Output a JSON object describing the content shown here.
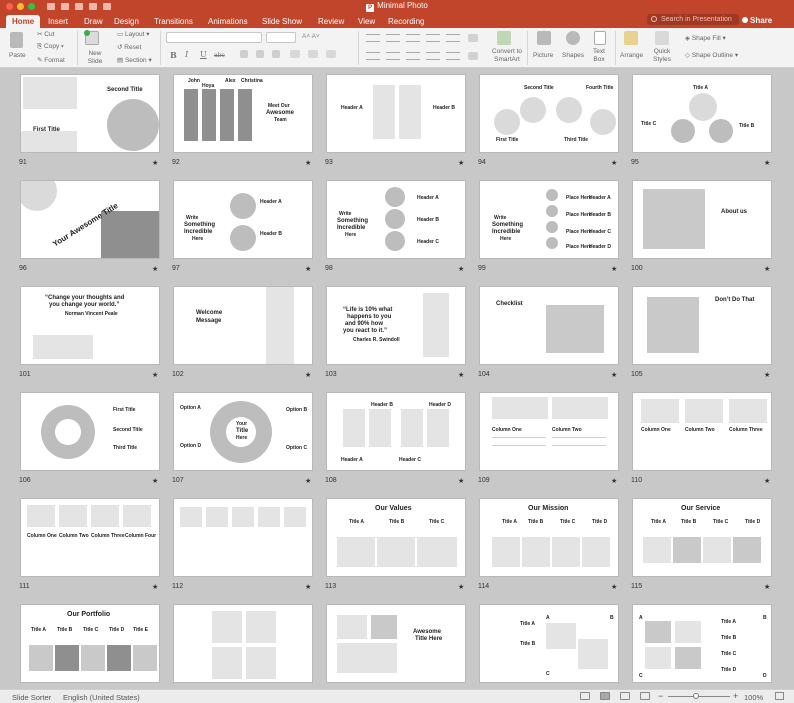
{
  "app": {
    "window_title": "Minimal Photo",
    "colors": {
      "accent": "#c0452b",
      "tab_bg": "#f3f3f3",
      "sorter_bg": "#c8c8c8"
    }
  },
  "tabs": [
    "Home",
    "Insert",
    "Draw",
    "Design",
    "Transitions",
    "Animations",
    "Slide Show",
    "Review",
    "View",
    "Recording"
  ],
  "active_tab": "Home",
  "search": {
    "placeholder": "Search in Presentation"
  },
  "share_label": "Share",
  "ribbon": {
    "paste": "Paste",
    "cut": "Cut",
    "copy": "Copy",
    "format": "Format",
    "new_slide": "New Slide",
    "layout": "Layout",
    "reset": "Reset",
    "section": "Section",
    "convert_smartart": "Convert to SmartArt",
    "picture": "Picture",
    "shapes": "Shapes",
    "text_box": "Text Box",
    "arrange": "Arrange",
    "quick_styles": "Quick Styles",
    "shape_fill": "Shape Fill",
    "shape_outline": "Shape Outline",
    "bold": "B",
    "italic": "I",
    "underline": "U",
    "strike": "abc",
    "font_up": "A˄",
    "font_down": "A˅"
  },
  "slides": [
    {
      "num": "91",
      "texts": [
        "Second Title",
        "First Title"
      ]
    },
    {
      "num": "92",
      "texts": [
        "John",
        "Hoya",
        "Alex",
        "Christina",
        "Meet Our",
        "Awesome",
        "Team"
      ]
    },
    {
      "num": "93",
      "texts": [
        "Header A",
        "Header B"
      ]
    },
    {
      "num": "94",
      "texts": [
        "Second Title",
        "Fourth Title",
        "First Title",
        "Third Title"
      ]
    },
    {
      "num": "95",
      "texts": [
        "Title A",
        "Title C",
        "Title B"
      ]
    },
    {
      "num": "96",
      "texts": [
        "Your Awesome Title"
      ]
    },
    {
      "num": "97",
      "texts": [
        "Write",
        "Something",
        "Incredible",
        "Here",
        "Header A",
        "Header B"
      ]
    },
    {
      "num": "98",
      "texts": [
        "Write",
        "Something",
        "Incredible",
        "Here",
        "Header A",
        "Header B",
        "Header C"
      ]
    },
    {
      "num": "99",
      "texts": [
        "Write",
        "Something",
        "Incredible",
        "Here",
        "Place Here",
        "Header A",
        "Place Here",
        "Header B",
        "Place Here",
        "Header C",
        "Place Here",
        "Header D"
      ]
    },
    {
      "num": "100",
      "texts": [
        "About us"
      ]
    },
    {
      "num": "101",
      "texts": [
        "“Change your thoughts and",
        "you change your world.”",
        "Norman Vincent Peale"
      ]
    },
    {
      "num": "102",
      "texts": [
        "Welcome",
        "Message"
      ]
    },
    {
      "num": "103",
      "texts": [
        "“Life is 10% what",
        "happens to you",
        "and 90% how",
        "you react to it.”",
        "Charles R. Swindoll"
      ]
    },
    {
      "num": "104",
      "texts": [
        "Checklist"
      ]
    },
    {
      "num": "105",
      "texts": [
        "Don’t Do That"
      ]
    },
    {
      "num": "106",
      "texts": [
        "First Title",
        "Second Title",
        "Third Title"
      ]
    },
    {
      "num": "107",
      "texts": [
        "Your",
        "Title",
        "Here",
        "Option A",
        "Option B",
        "Option D",
        "Option C"
      ]
    },
    {
      "num": "108",
      "texts": [
        "Header B",
        "Header D",
        "Header A",
        "Header C"
      ]
    },
    {
      "num": "109",
      "texts": [
        "Column One",
        "Column Two"
      ]
    },
    {
      "num": "110",
      "texts": [
        "Column One",
        "Column Two",
        "Column Three"
      ]
    },
    {
      "num": "111",
      "texts": [
        "Column One",
        "Column Two",
        "Column Three",
        "Column Four"
      ]
    },
    {
      "num": "112",
      "texts": []
    },
    {
      "num": "113",
      "texts": [
        "Our Values",
        "Title A",
        "Title B",
        "Title C"
      ]
    },
    {
      "num": "114",
      "texts": [
        "Our Mission",
        "Title A",
        "Title B",
        "Title C",
        "Title D"
      ]
    },
    {
      "num": "115",
      "texts": [
        "Our Service",
        "Title A",
        "Title B",
        "Title C",
        "Title D"
      ]
    },
    {
      "num": "116",
      "texts": [
        "Our Portfolio",
        "Title A",
        "Title B",
        "Title C",
        "Title D",
        "Title E"
      ]
    },
    {
      "num": "117",
      "texts": []
    },
    {
      "num": "118",
      "texts": [
        "Awesome",
        "Title Here"
      ]
    },
    {
      "num": "119",
      "texts": [
        "Title A",
        "Title B",
        "A",
        "B",
        "C"
      ]
    },
    {
      "num": "120",
      "texts": [
        "A",
        "B",
        "C",
        "D",
        "Title A",
        "Title B",
        "Title C",
        "Title D"
      ]
    }
  ],
  "star_glyph": "★",
  "status": {
    "view": "Slide Sorter",
    "language": "English (United States)",
    "zoom": "100%",
    "zoom_fraction": 0.45
  }
}
